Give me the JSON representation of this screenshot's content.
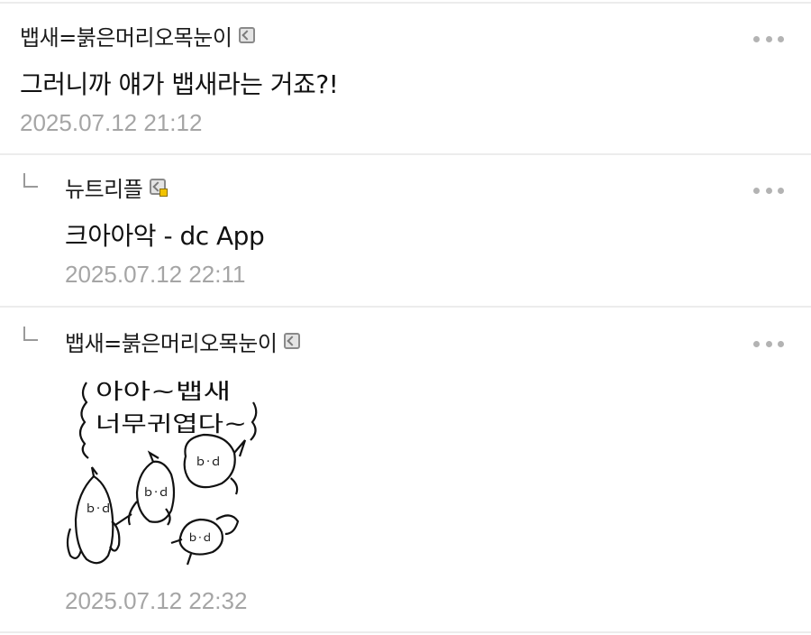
{
  "comments": [
    {
      "nickname": "뱁새=붉은머리오목눈이",
      "badge": "fixed-nick-icon",
      "text": "그러니까 얘가 뱁새라는 거죠?!",
      "time": "2025.07.12 21:12",
      "is_reply": false
    },
    {
      "nickname": "뉴트리플",
      "badge": "fixed-nick-sub-icon",
      "text": "크아아악 - dc App",
      "time": "2025.07.12 22:11",
      "is_reply": true
    },
    {
      "nickname": "뱁새=붉은머리오목눈이",
      "badge": "fixed-nick-icon",
      "dccon": {
        "line1": "아아~뱁새",
        "line2": "너무귀엽다~"
      },
      "time": "2025.07.12 22:32",
      "is_reply": true
    }
  ],
  "colors": {
    "divider": "#ececec",
    "time": "#a5a5a5",
    "more_dots": "#b3b3b3",
    "badge_dot": "#f2c300"
  }
}
